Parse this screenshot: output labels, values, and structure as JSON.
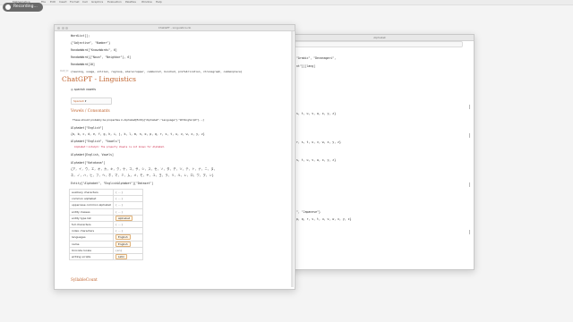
{
  "menubar": {
    "items": [
      "Mathematica",
      "File",
      "Edit",
      "Insert",
      "Format",
      "Cell",
      "Graphics",
      "Evaluation",
      "Palettes",
      "Window",
      "Help"
    ]
  },
  "recording": {
    "label": "Recording..."
  },
  "back_window": {
    "title": "Alphabet",
    "lines": [
      "\"Arabic\", \"Devanagari\",",
      "nt\"]][lang]",
      "s, t, u, v, w, x, y, z}",
      "r, s, t, u, v, w, x, y, z}",
      "s, t, u, v, w, x, y, z}",
      "\", \"Japanese\"}",
      "p, q, r, s, t, u, v, w, x, y, z}"
    ]
  },
  "front_window": {
    "title": "ChatGPT - Linguistics.nb",
    "code_lines": [
      "WordList[];",
      "{\"Adjective\", \"Number\"}",
      "RandomWord[\"KnownWords\", 6]",
      "RandomWord[{\"Noun\", \"Neighbor\"}, 6]",
      "RandomWord[10]"
    ],
    "word_output": "{lawning, usage, ellilen, regroup, sharecropper, communist, bunched, prefabrication, chronograph, commonplace}",
    "out_label": "Out[ ]=",
    "heading": "ChatGPT - Linguistics",
    "search_label": "spanish vowels",
    "dropdown": "Spanish",
    "subheading": "Vowels / Consonants",
    "note": "These should probably be properties in Alphabet[Entity[\"Alphabet\", \"Language\"], \"WritingScript\"], ...]",
    "alpha_inputs": [
      "Alphabet[\"English\"]",
      "Alphabet[\"English\", \"Vowels\"]",
      "Alphabet[English, Vowels]",
      "Alphabet[\"Katakana\"]"
    ],
    "alpha_outputs": [
      "{a, b, c, d, e, f, g, h, i, j, k, l, m, n, o, p, q, r, s, t, u, v, w, x, y, z}",
      "Alphabet::notalph: The property Vowels is not known for Alphabet."
    ],
    "katakana_line1": "{ア, イ, ウ, エ, オ, カ, キ, ク, ケ, コ, サ, シ, ス, セ, ソ, タ, チ, ツ, テ, ト, ナ, ニ, ヌ,",
    "katakana_line2": "ネ, ノ, ハ, ヒ, フ, ヘ, ホ, マ, ミ, ム, メ, モ, ヤ, ユ, ヨ, ラ, リ, ル, レ, ロ, ワ, ヲ, ン}",
    "entity_input": "Entity[\"Alphabet\", \"EnglishAlphabet\"][\"Dataset\"]",
    "table": [
      {
        "key": "auxiliary characters",
        "value": "{ ... }"
      },
      {
        "key": "common alphabet",
        "value": "{ ... }"
      },
      {
        "key": "uppercase common alphabet",
        "value": "{ ... }"
      },
      {
        "key": "entity classes",
        "value": "{ ... }"
      },
      {
        "key": "entity type list",
        "value": "alphabet"
      },
      {
        "key": "full characters",
        "value": "{ ... }"
      },
      {
        "key": "index characters",
        "value": "{ ... }"
      },
      {
        "key": "languages",
        "value": "English"
      },
      {
        "key": "name",
        "value": "English"
      },
      {
        "key": "Unicode locale",
        "value": "{en}"
      },
      {
        "key": "writing scripts",
        "value": "Latin"
      }
    ],
    "syllable_heading": "SyllableCount"
  }
}
